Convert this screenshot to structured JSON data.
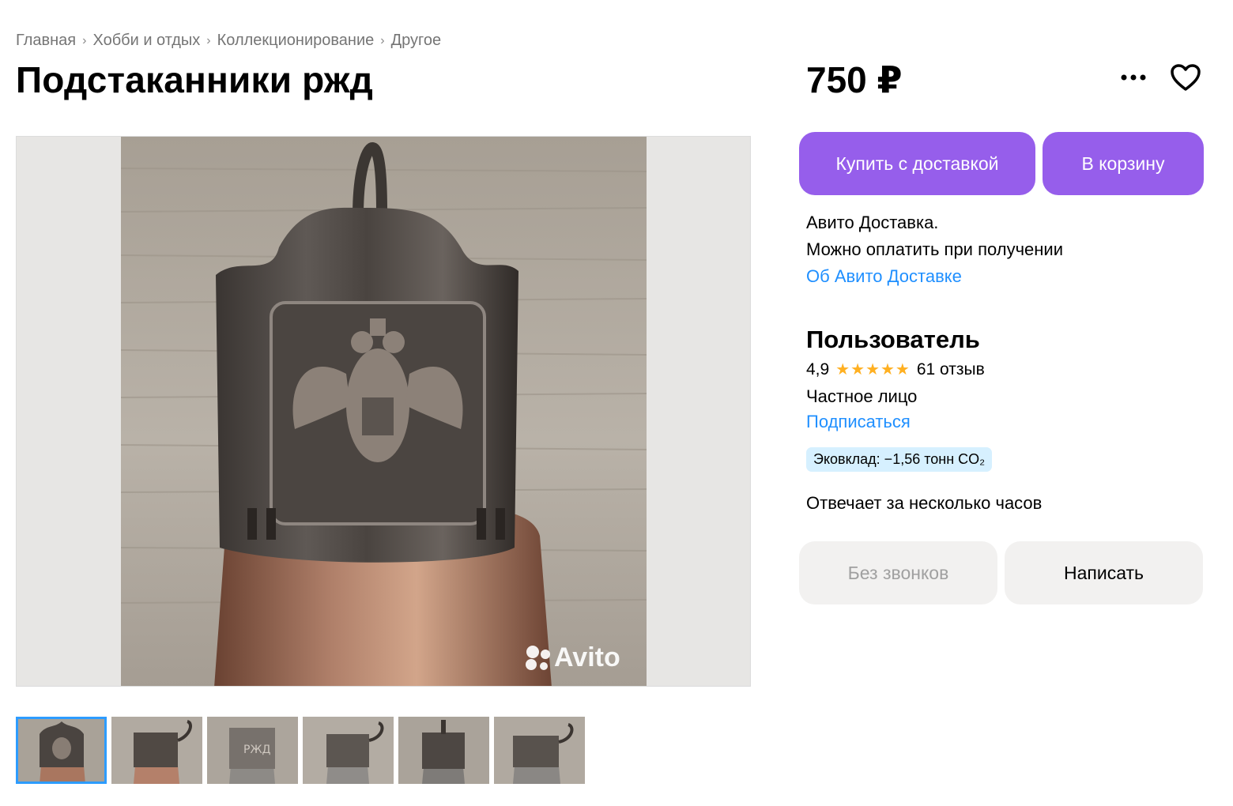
{
  "breadcrumb": [
    "Главная",
    "Хобби и отдых",
    "Коллекционирование",
    "Другое"
  ],
  "title": "Подстаканники ржд",
  "price": "750 ₽",
  "actions": {
    "more_icon": "more-dots-icon",
    "favorite_icon": "heart-icon"
  },
  "gallery": {
    "watermark": "Avito",
    "thumbnail_count": 6,
    "active_thumbnail": 1
  },
  "buy_button": "Купить с доставкой",
  "cart_button": "В корзину",
  "delivery": {
    "line1": "Авито Доставка.",
    "line2": "Можно оплатить при получении",
    "link": "Об Авито Доставке"
  },
  "seller": {
    "name": "Пользователь",
    "rating": "4,9",
    "stars": "★★★★★",
    "reviews": "61 отзыв",
    "type": "Частное лицо",
    "subscribe": "Подписаться",
    "eco": "Эковклад: −1,56 тонн CO₂",
    "response": "Отвечает за несколько часов"
  },
  "no_calls_button": "Без звонков",
  "write_button": "Написать",
  "colors": {
    "accent": "#965eeb",
    "link": "#1f8fff",
    "star": "#ffb021",
    "eco_bg": "#d6f0ff"
  }
}
